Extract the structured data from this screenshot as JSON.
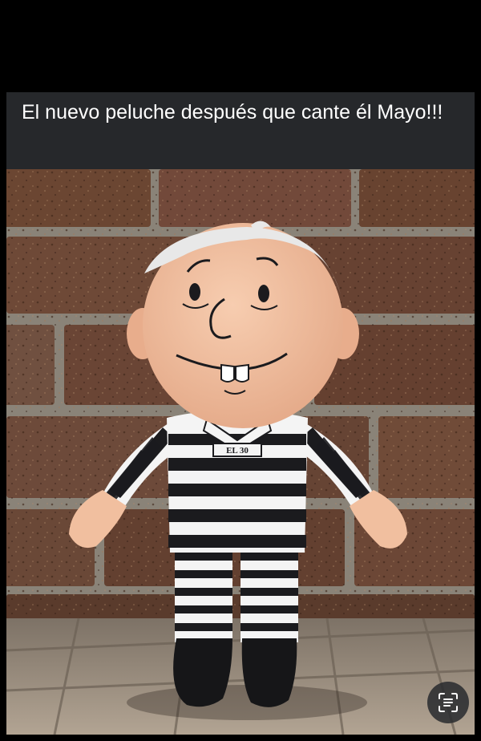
{
  "post": {
    "caption": "El nuevo peluche después que cante él Mayo!!!"
  },
  "photo": {
    "shirt_label": "EL 30"
  },
  "controls": {
    "lens_icon": "scan-text-icon"
  },
  "colors": {
    "caption_bg": "#26282b",
    "caption_text": "#ffffff",
    "brick": "#6b4632",
    "mortar": "#8a8378",
    "skin": "#f1bf9f",
    "hair": "#e8e8e8",
    "stripe_dark": "#1b1b1e",
    "stripe_light": "#f4f4f4",
    "ground": "#9c8f80"
  }
}
